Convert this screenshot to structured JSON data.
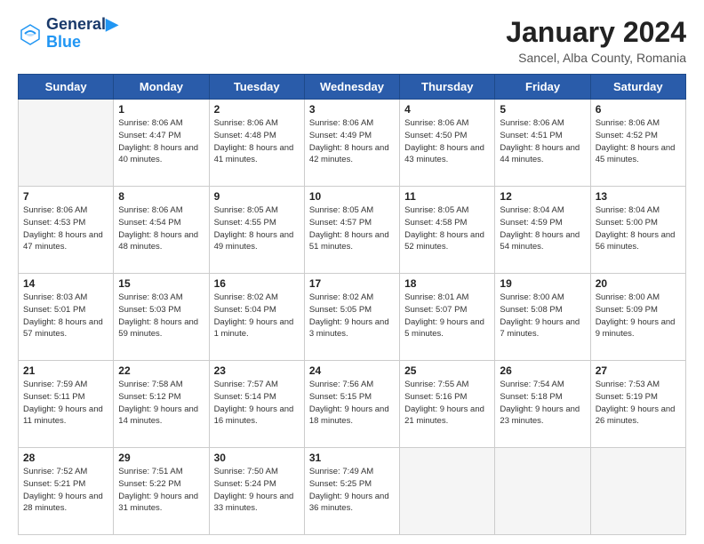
{
  "header": {
    "logo_line1": "General",
    "logo_line2": "Blue",
    "title": "January 2024",
    "subtitle": "Sancel, Alba County, Romania"
  },
  "weekdays": [
    "Sunday",
    "Monday",
    "Tuesday",
    "Wednesday",
    "Thursday",
    "Friday",
    "Saturday"
  ],
  "weeks": [
    [
      {
        "day": "",
        "empty": true
      },
      {
        "day": "1",
        "sunrise": "8:06 AM",
        "sunset": "4:47 PM",
        "daylight": "8 hours and 40 minutes."
      },
      {
        "day": "2",
        "sunrise": "8:06 AM",
        "sunset": "4:48 PM",
        "daylight": "8 hours and 41 minutes."
      },
      {
        "day": "3",
        "sunrise": "8:06 AM",
        "sunset": "4:49 PM",
        "daylight": "8 hours and 42 minutes."
      },
      {
        "day": "4",
        "sunrise": "8:06 AM",
        "sunset": "4:50 PM",
        "daylight": "8 hours and 43 minutes."
      },
      {
        "day": "5",
        "sunrise": "8:06 AM",
        "sunset": "4:51 PM",
        "daylight": "8 hours and 44 minutes."
      },
      {
        "day": "6",
        "sunrise": "8:06 AM",
        "sunset": "4:52 PM",
        "daylight": "8 hours and 45 minutes."
      }
    ],
    [
      {
        "day": "7",
        "sunrise": "8:06 AM",
        "sunset": "4:53 PM",
        "daylight": "8 hours and 47 minutes."
      },
      {
        "day": "8",
        "sunrise": "8:06 AM",
        "sunset": "4:54 PM",
        "daylight": "8 hours and 48 minutes."
      },
      {
        "day": "9",
        "sunrise": "8:05 AM",
        "sunset": "4:55 PM",
        "daylight": "8 hours and 49 minutes."
      },
      {
        "day": "10",
        "sunrise": "8:05 AM",
        "sunset": "4:57 PM",
        "daylight": "8 hours and 51 minutes."
      },
      {
        "day": "11",
        "sunrise": "8:05 AM",
        "sunset": "4:58 PM",
        "daylight": "8 hours and 52 minutes."
      },
      {
        "day": "12",
        "sunrise": "8:04 AM",
        "sunset": "4:59 PM",
        "daylight": "8 hours and 54 minutes."
      },
      {
        "day": "13",
        "sunrise": "8:04 AM",
        "sunset": "5:00 PM",
        "daylight": "8 hours and 56 minutes."
      }
    ],
    [
      {
        "day": "14",
        "sunrise": "8:03 AM",
        "sunset": "5:01 PM",
        "daylight": "8 hours and 57 minutes."
      },
      {
        "day": "15",
        "sunrise": "8:03 AM",
        "sunset": "5:03 PM",
        "daylight": "8 hours and 59 minutes."
      },
      {
        "day": "16",
        "sunrise": "8:02 AM",
        "sunset": "5:04 PM",
        "daylight": "9 hours and 1 minute."
      },
      {
        "day": "17",
        "sunrise": "8:02 AM",
        "sunset": "5:05 PM",
        "daylight": "9 hours and 3 minutes."
      },
      {
        "day": "18",
        "sunrise": "8:01 AM",
        "sunset": "5:07 PM",
        "daylight": "9 hours and 5 minutes."
      },
      {
        "day": "19",
        "sunrise": "8:00 AM",
        "sunset": "5:08 PM",
        "daylight": "9 hours and 7 minutes."
      },
      {
        "day": "20",
        "sunrise": "8:00 AM",
        "sunset": "5:09 PM",
        "daylight": "9 hours and 9 minutes."
      }
    ],
    [
      {
        "day": "21",
        "sunrise": "7:59 AM",
        "sunset": "5:11 PM",
        "daylight": "9 hours and 11 minutes."
      },
      {
        "day": "22",
        "sunrise": "7:58 AM",
        "sunset": "5:12 PM",
        "daylight": "9 hours and 14 minutes."
      },
      {
        "day": "23",
        "sunrise": "7:57 AM",
        "sunset": "5:14 PM",
        "daylight": "9 hours and 16 minutes."
      },
      {
        "day": "24",
        "sunrise": "7:56 AM",
        "sunset": "5:15 PM",
        "daylight": "9 hours and 18 minutes."
      },
      {
        "day": "25",
        "sunrise": "7:55 AM",
        "sunset": "5:16 PM",
        "daylight": "9 hours and 21 minutes."
      },
      {
        "day": "26",
        "sunrise": "7:54 AM",
        "sunset": "5:18 PM",
        "daylight": "9 hours and 23 minutes."
      },
      {
        "day": "27",
        "sunrise": "7:53 AM",
        "sunset": "5:19 PM",
        "daylight": "9 hours and 26 minutes."
      }
    ],
    [
      {
        "day": "28",
        "sunrise": "7:52 AM",
        "sunset": "5:21 PM",
        "daylight": "9 hours and 28 minutes."
      },
      {
        "day": "29",
        "sunrise": "7:51 AM",
        "sunset": "5:22 PM",
        "daylight": "9 hours and 31 minutes."
      },
      {
        "day": "30",
        "sunrise": "7:50 AM",
        "sunset": "5:24 PM",
        "daylight": "9 hours and 33 minutes."
      },
      {
        "day": "31",
        "sunrise": "7:49 AM",
        "sunset": "5:25 PM",
        "daylight": "9 hours and 36 minutes."
      },
      {
        "day": "",
        "empty": true
      },
      {
        "day": "",
        "empty": true
      },
      {
        "day": "",
        "empty": true
      }
    ]
  ]
}
